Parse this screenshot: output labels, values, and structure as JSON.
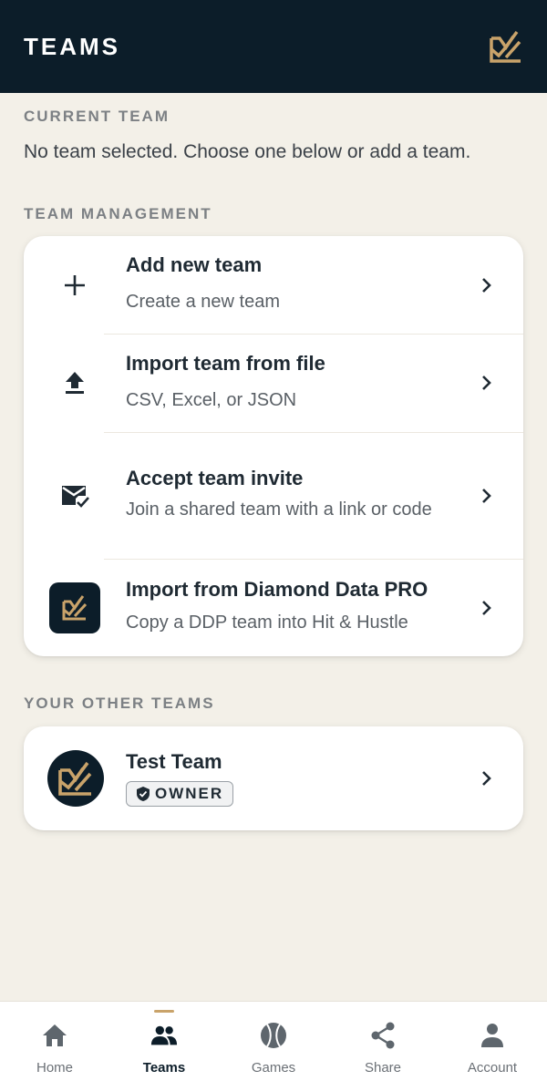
{
  "header": {
    "title": "TEAMS",
    "logo_icon": "brand-chart-logo",
    "accent_color": "#c9a36a",
    "bg_color": "#0c1d29"
  },
  "current_team": {
    "label": "CURRENT TEAM",
    "message": "No team selected. Choose one below or add a team."
  },
  "management": {
    "label": "TEAM MANAGEMENT",
    "items": [
      {
        "title": "Add new team",
        "subtitle": "Create a new team",
        "icon": "plus-icon"
      },
      {
        "title": "Import team from file",
        "subtitle": "CSV, Excel, or JSON",
        "icon": "upload-icon"
      },
      {
        "title": "Accept team invite",
        "subtitle": "Join a shared team with a link or code",
        "icon": "mail-check-icon"
      },
      {
        "title": "Import from Diamond Data PRO",
        "subtitle": "Copy a DDP team into Hit & Hustle",
        "icon": "ddp-logo-icon"
      }
    ]
  },
  "other_teams": {
    "label": "YOUR OTHER TEAMS",
    "teams": [
      {
        "name": "Test Team",
        "role": "OWNER"
      }
    ]
  },
  "bottom_nav": {
    "items": [
      {
        "label": "Home",
        "icon": "home-icon"
      },
      {
        "label": "Teams",
        "icon": "people-icon",
        "active": true
      },
      {
        "label": "Games",
        "icon": "baseball-icon"
      },
      {
        "label": "Share",
        "icon": "share-icon"
      },
      {
        "label": "Account",
        "icon": "person-icon"
      }
    ]
  }
}
